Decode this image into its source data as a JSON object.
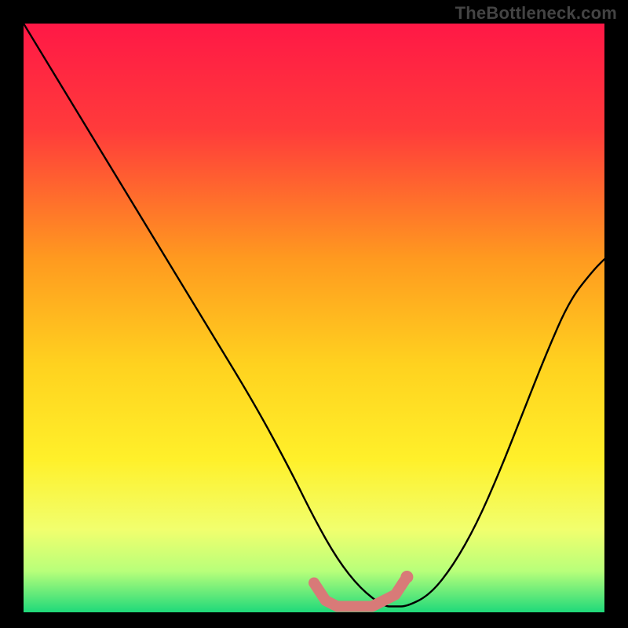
{
  "watermark": "TheBottleneck.com",
  "chart_data": {
    "type": "line",
    "title": "",
    "xlabel": "",
    "ylabel": "",
    "xlim": [
      0,
      100
    ],
    "ylim": [
      0,
      100
    ],
    "gradient_stops": [
      {
        "offset": 0,
        "color": "#ff1846"
      },
      {
        "offset": 18,
        "color": "#ff3b3b"
      },
      {
        "offset": 40,
        "color": "#ff9a1f"
      },
      {
        "offset": 58,
        "color": "#ffd21f"
      },
      {
        "offset": 74,
        "color": "#fff02a"
      },
      {
        "offset": 86,
        "color": "#f1ff6e"
      },
      {
        "offset": 93,
        "color": "#b8ff7a"
      },
      {
        "offset": 100,
        "color": "#1fd97a"
      }
    ],
    "series": [
      {
        "name": "bottleneck-curve",
        "x": [
          0,
          8,
          16,
          24,
          32,
          40,
          46,
          50,
          54,
          58,
          62,
          64,
          66,
          70,
          74,
          78,
          82,
          86,
          90,
          94,
          98,
          100
        ],
        "y": [
          100,
          87,
          74,
          61,
          48,
          35,
          24,
          16,
          9,
          4,
          1,
          1,
          1,
          3,
          8,
          15,
          24,
          34,
          44,
          53,
          58,
          60
        ]
      }
    ],
    "marker_band": {
      "name": "optimal-range",
      "color": "#d87a78",
      "x": [
        50,
        52,
        54,
        56,
        58,
        60,
        62,
        64,
        66
      ],
      "y": [
        5,
        2,
        1,
        1,
        1,
        1,
        2,
        3,
        6
      ]
    },
    "marker_dot": {
      "x": 66,
      "y": 6,
      "color": "#d87a78"
    }
  }
}
